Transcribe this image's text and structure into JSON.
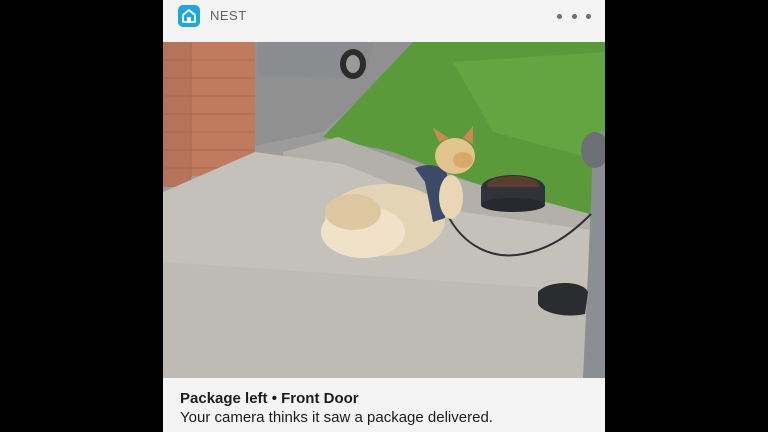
{
  "notification": {
    "app_name": "NEST",
    "app_icon": "home-icon",
    "accent_color": "#1fa7e0",
    "more_icon": "more-dots-icon",
    "title": "Package left • Front Door",
    "body": "Your camera thinks it saw a package delivered.",
    "snapshot_subject": "corgi dog on a leash lying on a concrete porch"
  }
}
